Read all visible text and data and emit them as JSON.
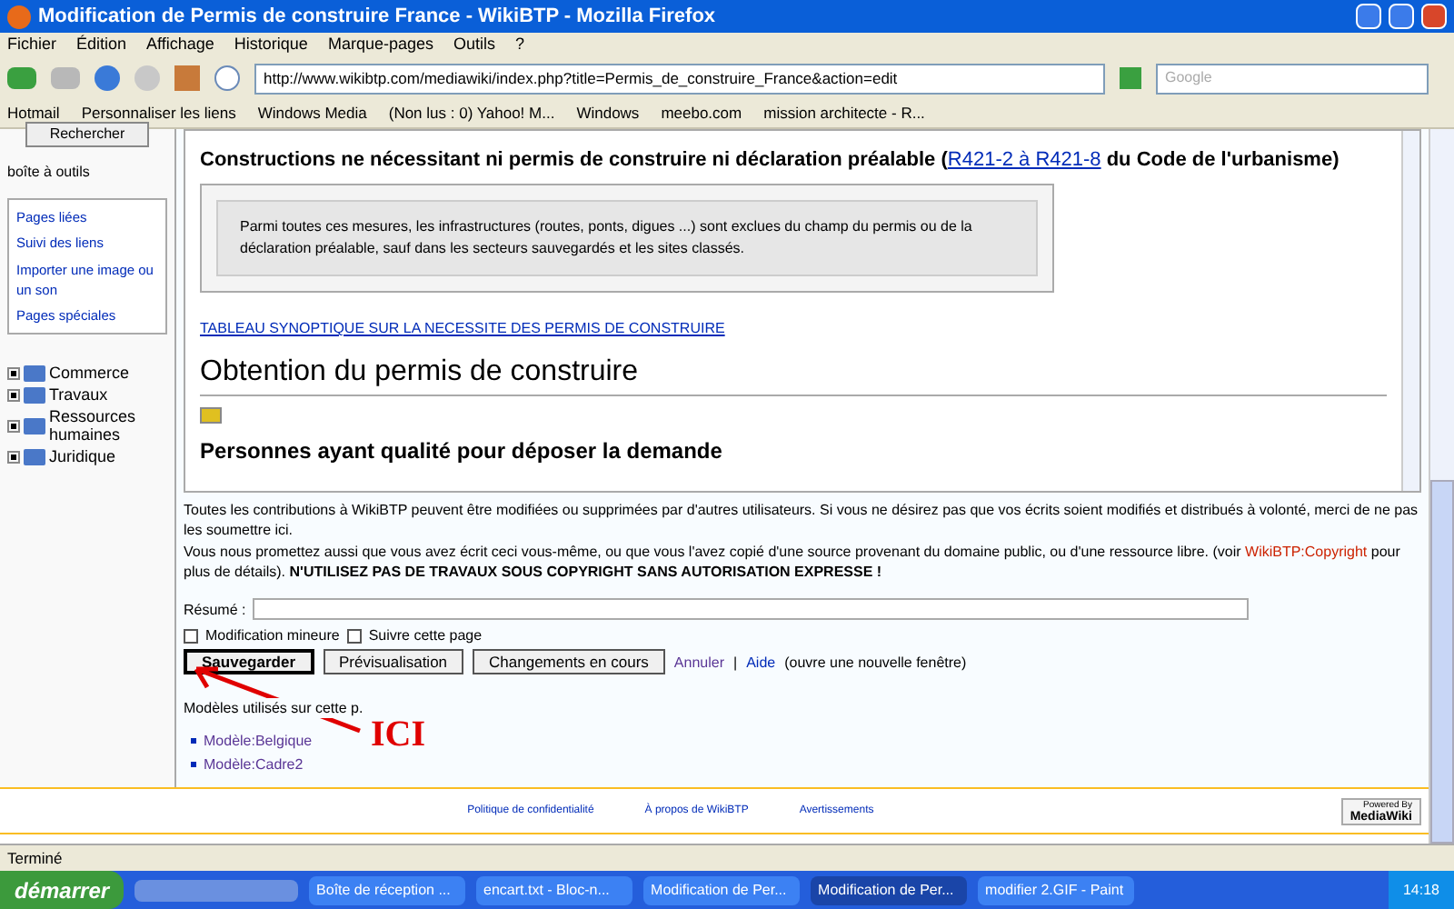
{
  "window": {
    "title": "Modification de Permis de construire France - WikiBTP - Mozilla Firefox"
  },
  "menu": [
    "Fichier",
    "Édition",
    "Affichage",
    "Historique",
    "Marque-pages",
    "Outils",
    "?"
  ],
  "toolbar": {
    "url": "http://www.wikibtp.com/mediawiki/index.php?title=Permis_de_construire_France&action=edit",
    "search_placeholder": "Google"
  },
  "bookmarks": [
    "Hotmail",
    "Personnaliser les liens",
    "Windows Media",
    "(Non lus : 0) Yahoo! M...",
    "Windows",
    "meebo.com",
    "mission architecte - R..."
  ],
  "sidebar": {
    "search_button": "Rechercher",
    "toolbox_title": "boîte à outils",
    "toolbox_items": [
      "Pages liées",
      "Suivi des liens",
      "Importer une image ou un son",
      "Pages spéciales"
    ],
    "tree": [
      {
        "label": "Commerce",
        "expanded": false
      },
      {
        "label": "Travaux",
        "expanded": false
      },
      {
        "label": "Ressources humaines",
        "expanded": false
      },
      {
        "label": "Juridique",
        "expanded": false
      }
    ]
  },
  "editor": {
    "heading_before": "Constructions ne nécessitant ni permis de construire ni déclaration préalable (",
    "heading_link": "R421-2 à R421-8",
    "heading_after": " du Code de l'urbanisme)",
    "note": "Parmi toutes ces mesures, les infrastructures (routes, ponts, digues ...) sont exclues du champ du permis ou de la déclaration préalable, sauf dans les secteurs sauvegardés et les sites classés.",
    "table_link": "TABLEAU SYNOPTIQUE SUR LA NECESSITE DES PERMIS DE CONSTRUIRE",
    "section_title": "Obtention du permis de construire",
    "subsection_title": "Personnes ayant qualité pour déposer la demande"
  },
  "notice": {
    "paragraph_1": "Toutes les contributions à WikiBTP peuvent être modifiées ou supprimées par d'autres utilisateurs. Si vous ne désirez pas que vos écrits soient modifiés et distribués à volonté, merci de ne pas les soumettre ici.",
    "paragraph_2_before": "Vous nous promettez aussi que vous avez écrit ceci vous-même, ou que vous l'avez copié d'une source provenant du domaine public, ou d'une ressource libre. (voir ",
    "copyright_link": "WikiBTP:Copyright",
    "paragraph_2_after": " pour plus de détails).",
    "warning": "N'UTILISEZ PAS DE TRAVAUX SOUS COPYRIGHT SANS AUTORISATION EXPRESSE !"
  },
  "summary": {
    "label": "Résumé :"
  },
  "options": [
    {
      "label": "Modification mineure",
      "checked": false
    },
    {
      "label": "Suivre cette page",
      "checked": false
    }
  ],
  "buttons": [
    {
      "label": "Sauvegarder",
      "primary": true
    },
    {
      "label": "Prévisualisation",
      "primary": false
    },
    {
      "label": "Changements en cours",
      "primary": false
    }
  ],
  "cancel_link": "Annuler",
  "separator": "|",
  "help_link": "Aide",
  "help_note": "(ouvre une nouvelle fenêtre)",
  "templates": {
    "title": "Modèles utilisés sur cette p.",
    "items": [
      "Modèle:Belgique",
      "Modèle:Cadre2"
    ]
  },
  "annotation": "ICI",
  "footer": {
    "links": [
      "Politique de confidentialité",
      "À propos de WikiBTP",
      "Avertissements"
    ],
    "badge_top": "Powered By",
    "badge_bottom": "MediaWiki"
  },
  "status_bar": "Terminé",
  "taskbar": {
    "start": "démarrer",
    "tasks": [
      {
        "label": "Boîte de réception ...",
        "selected": false
      },
      {
        "label": "encart.txt - Bloc-n...",
        "selected": false
      },
      {
        "label": "Modification de Per...",
        "selected": false
      },
      {
        "label": "Modification de Per...",
        "selected": true
      },
      {
        "label": "modifier 2.GIF - Paint",
        "selected": false
      }
    ],
    "clock": "14:18"
  }
}
